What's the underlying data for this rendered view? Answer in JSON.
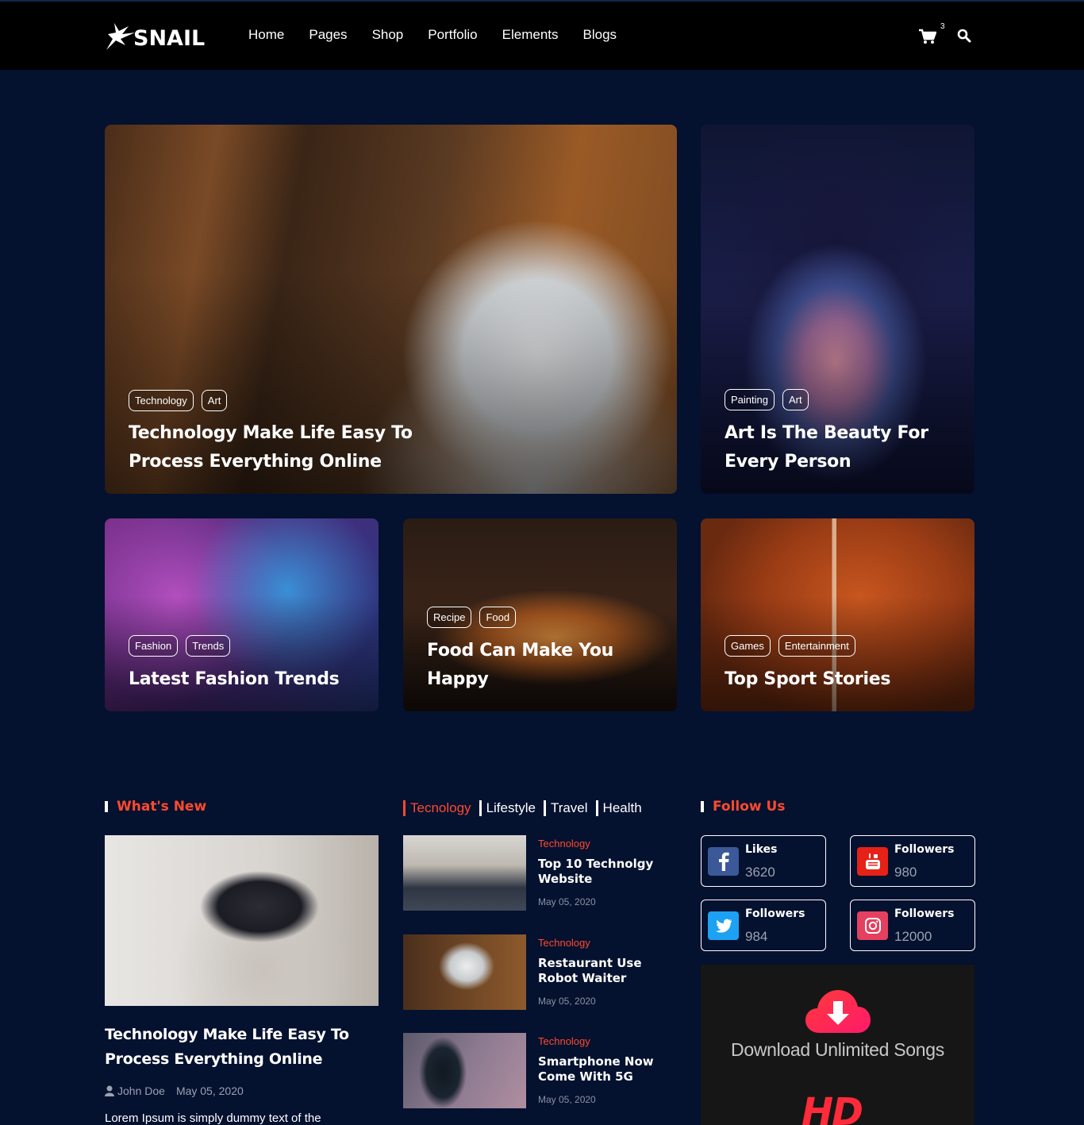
{
  "header": {
    "logo_text": "SNAIL",
    "nav": [
      "Home",
      "Pages",
      "Shop",
      "Portfolio",
      "Elements",
      "Blogs"
    ],
    "cart_count": "3"
  },
  "featured": [
    {
      "tags": [
        "Technology",
        "Art"
      ],
      "title_line1": "Technology Make Life Easy To",
      "title_line2": "Process Everything Online"
    },
    {
      "tags": [
        "Painting",
        "Art"
      ],
      "title_line1": "Art Is The Beauty For",
      "title_line2": "Every Person"
    },
    {
      "tags": [
        "Fashion",
        "Trends"
      ],
      "title_line1": "Latest Fashion Trends",
      "title_line2": ""
    },
    {
      "tags": [
        "Recipe",
        "Food"
      ],
      "title_line1": "Food Can Make You",
      "title_line2": "Happy"
    },
    {
      "tags": [
        "Games",
        "Entertainment"
      ],
      "title_line1": "Top Sport Stories",
      "title_line2": ""
    }
  ],
  "whats_new": {
    "heading": "What's New",
    "title_line1": "Technology Make Life Easy To",
    "title_line2": "Process Everything Online",
    "author": "John Doe",
    "date": "May 05, 2020",
    "excerpt": "Lorem Ipsum is simply dummy text of the"
  },
  "tabs": {
    "items": [
      "Tecnology",
      "Lifestyle",
      "Travel",
      "Health"
    ],
    "active": "Tecnology",
    "posts": [
      {
        "category": "Technology",
        "title_line1": "Top 10 Technolgy",
        "title_line2": "Website",
        "date": "May 05, 2020"
      },
      {
        "category": "Technology",
        "title_line1": "Restaurant Use",
        "title_line2": "Robot Waiter",
        "date": "May 05, 2020"
      },
      {
        "category": "Technology",
        "title_line1": "Smartphone Now",
        "title_line2": "Come With 5G",
        "date": "May 05, 2020"
      }
    ]
  },
  "follow": {
    "heading": "Follow Us",
    "items": [
      {
        "network": "facebook-icon",
        "label": "Likes",
        "count": "3620",
        "color": "#3b5998"
      },
      {
        "network": "youtube-icon",
        "label": "Followers",
        "count": "980",
        "color": "#e62117"
      },
      {
        "network": "twitter-icon",
        "label": "Followers",
        "count": "984",
        "color": "#1da1f2"
      },
      {
        "network": "instagram-icon",
        "label": "Followers",
        "count": "12000",
        "color": "#e4405f"
      }
    ]
  },
  "banner": {
    "text": "Download Unlimited Songs",
    "hd": "HD"
  },
  "colors": {
    "accent": "#ff4a2e",
    "background": "#04112f",
    "header": "#000000"
  }
}
